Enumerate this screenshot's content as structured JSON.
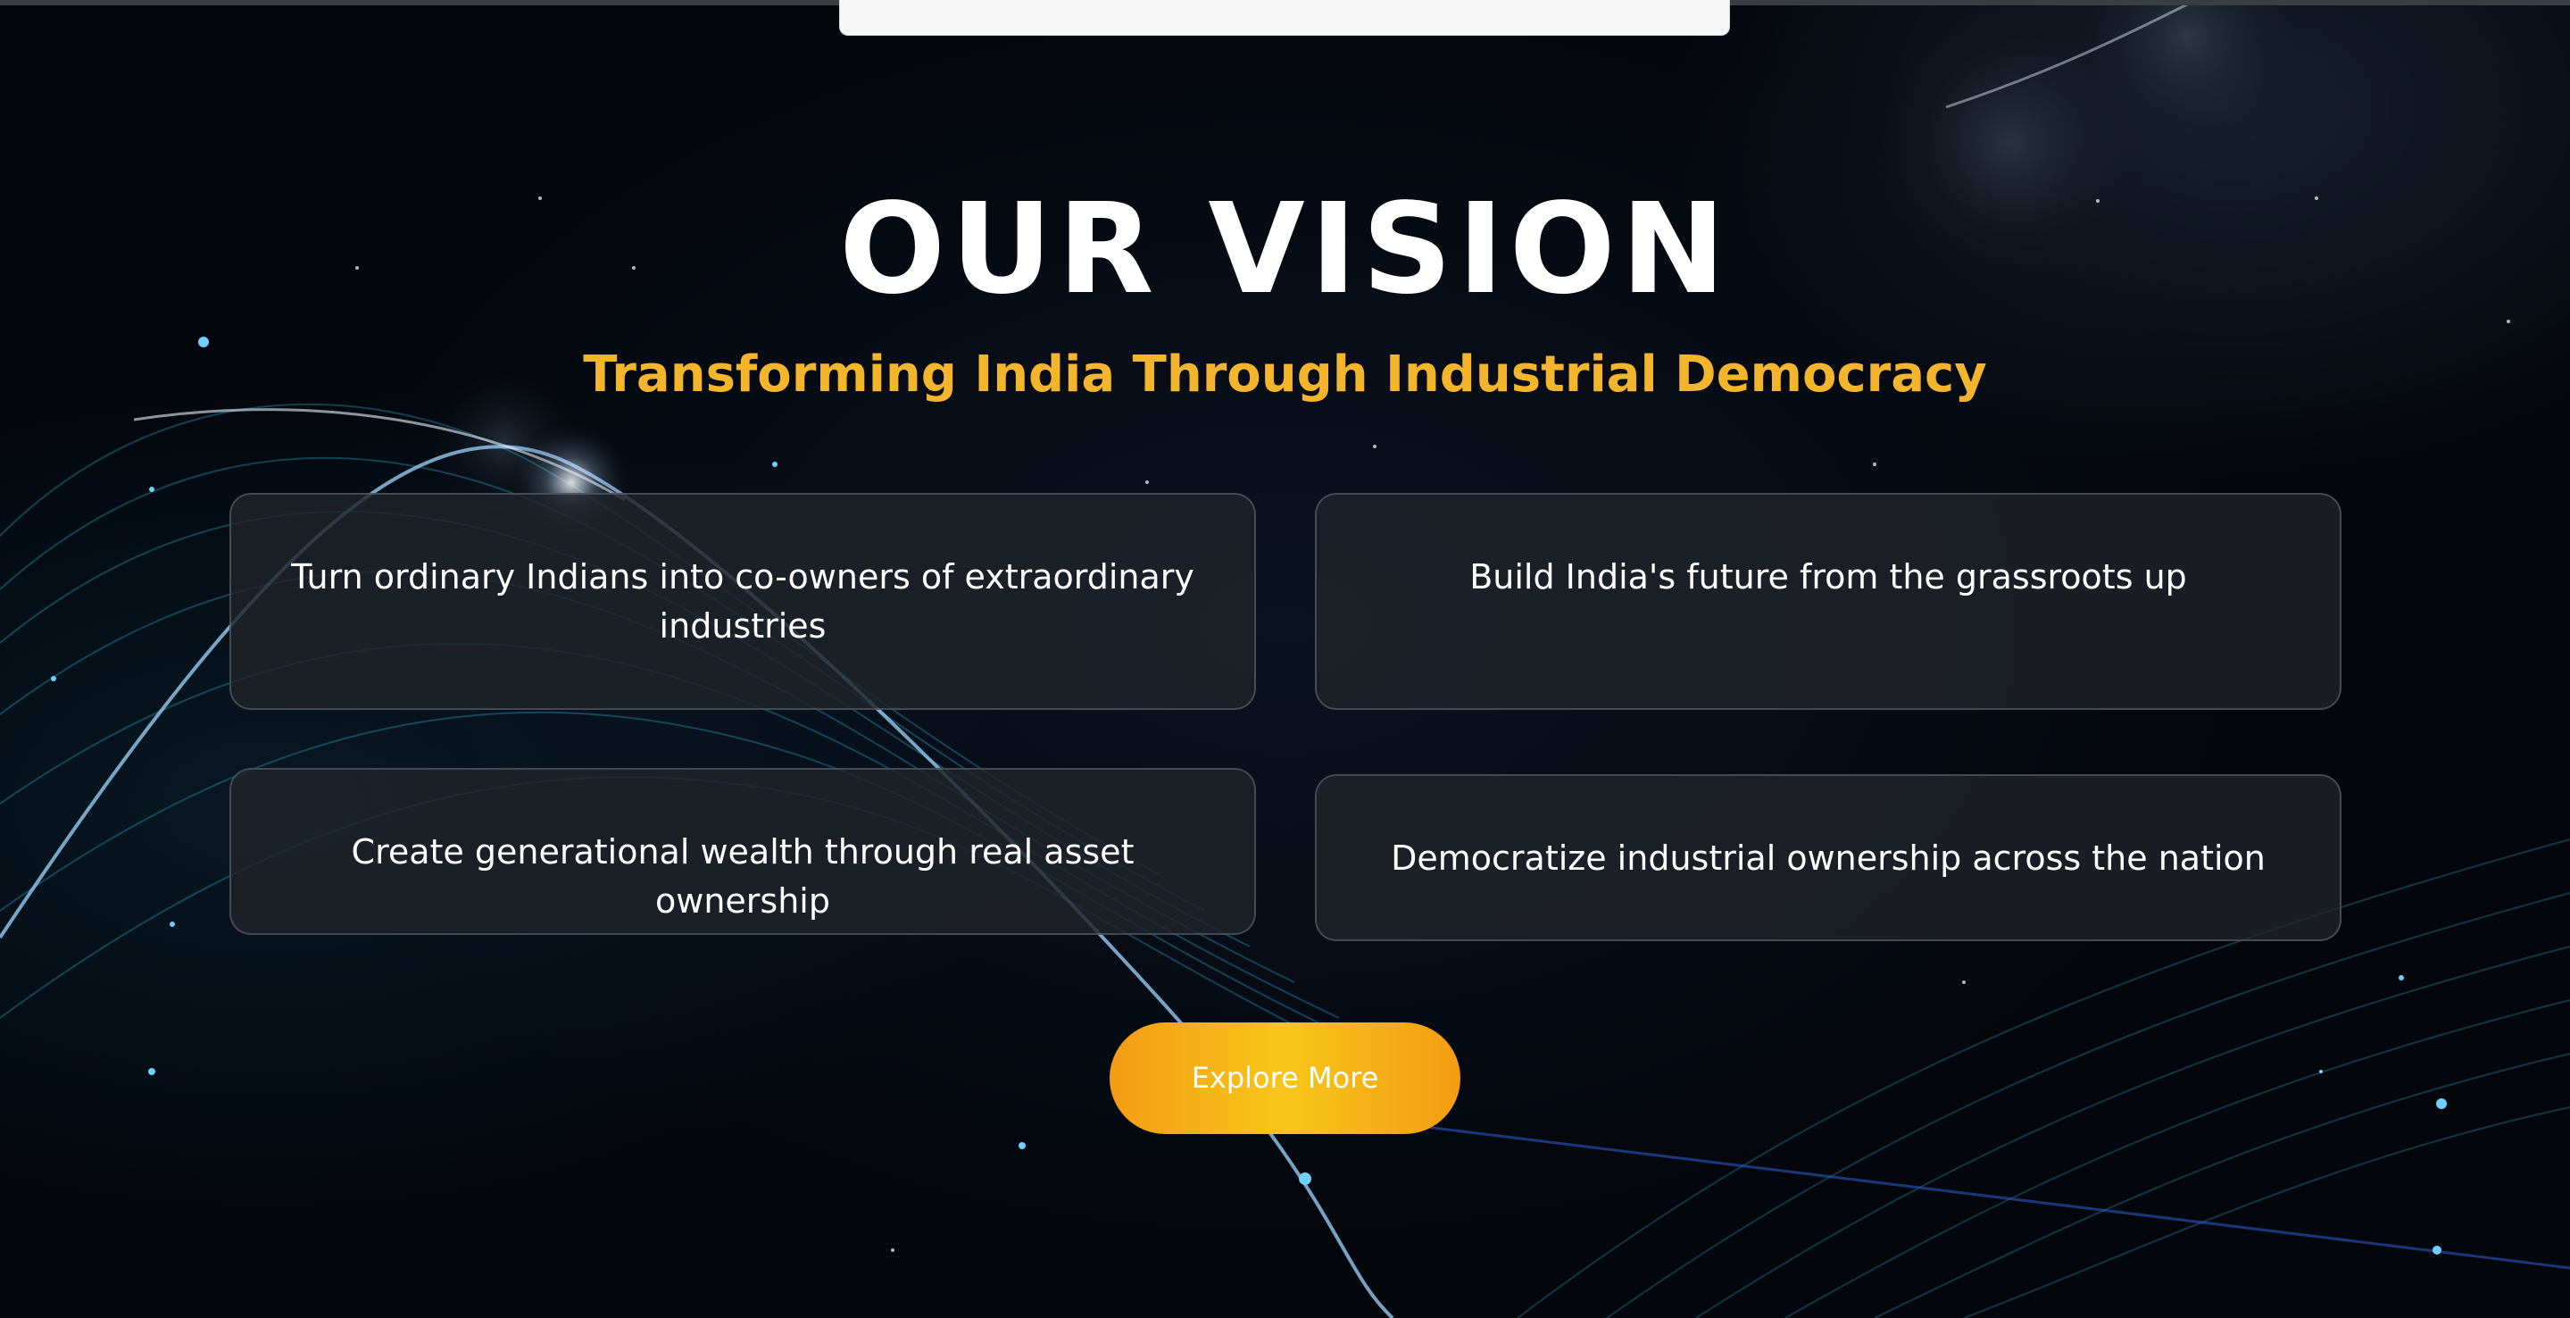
{
  "section": {
    "title": "OUR VISION",
    "subtitle": "Transforming India Through Industrial Democracy"
  },
  "cards": [
    {
      "text": "Turn ordinary Indians into co-owners of extraordinary industries"
    },
    {
      "text": "Build India's future from the grassroots up"
    },
    {
      "text": "Create generational wealth through real asset ownership"
    },
    {
      "text": "Democratize industrial ownership across the nation"
    }
  ],
  "cta": {
    "label": "Explore More"
  },
  "colors": {
    "background": "#04070d",
    "accent": "#f3b52c",
    "button_start": "#f39c12",
    "button_mid": "#f8c61b",
    "card_bg": "#20232a"
  }
}
